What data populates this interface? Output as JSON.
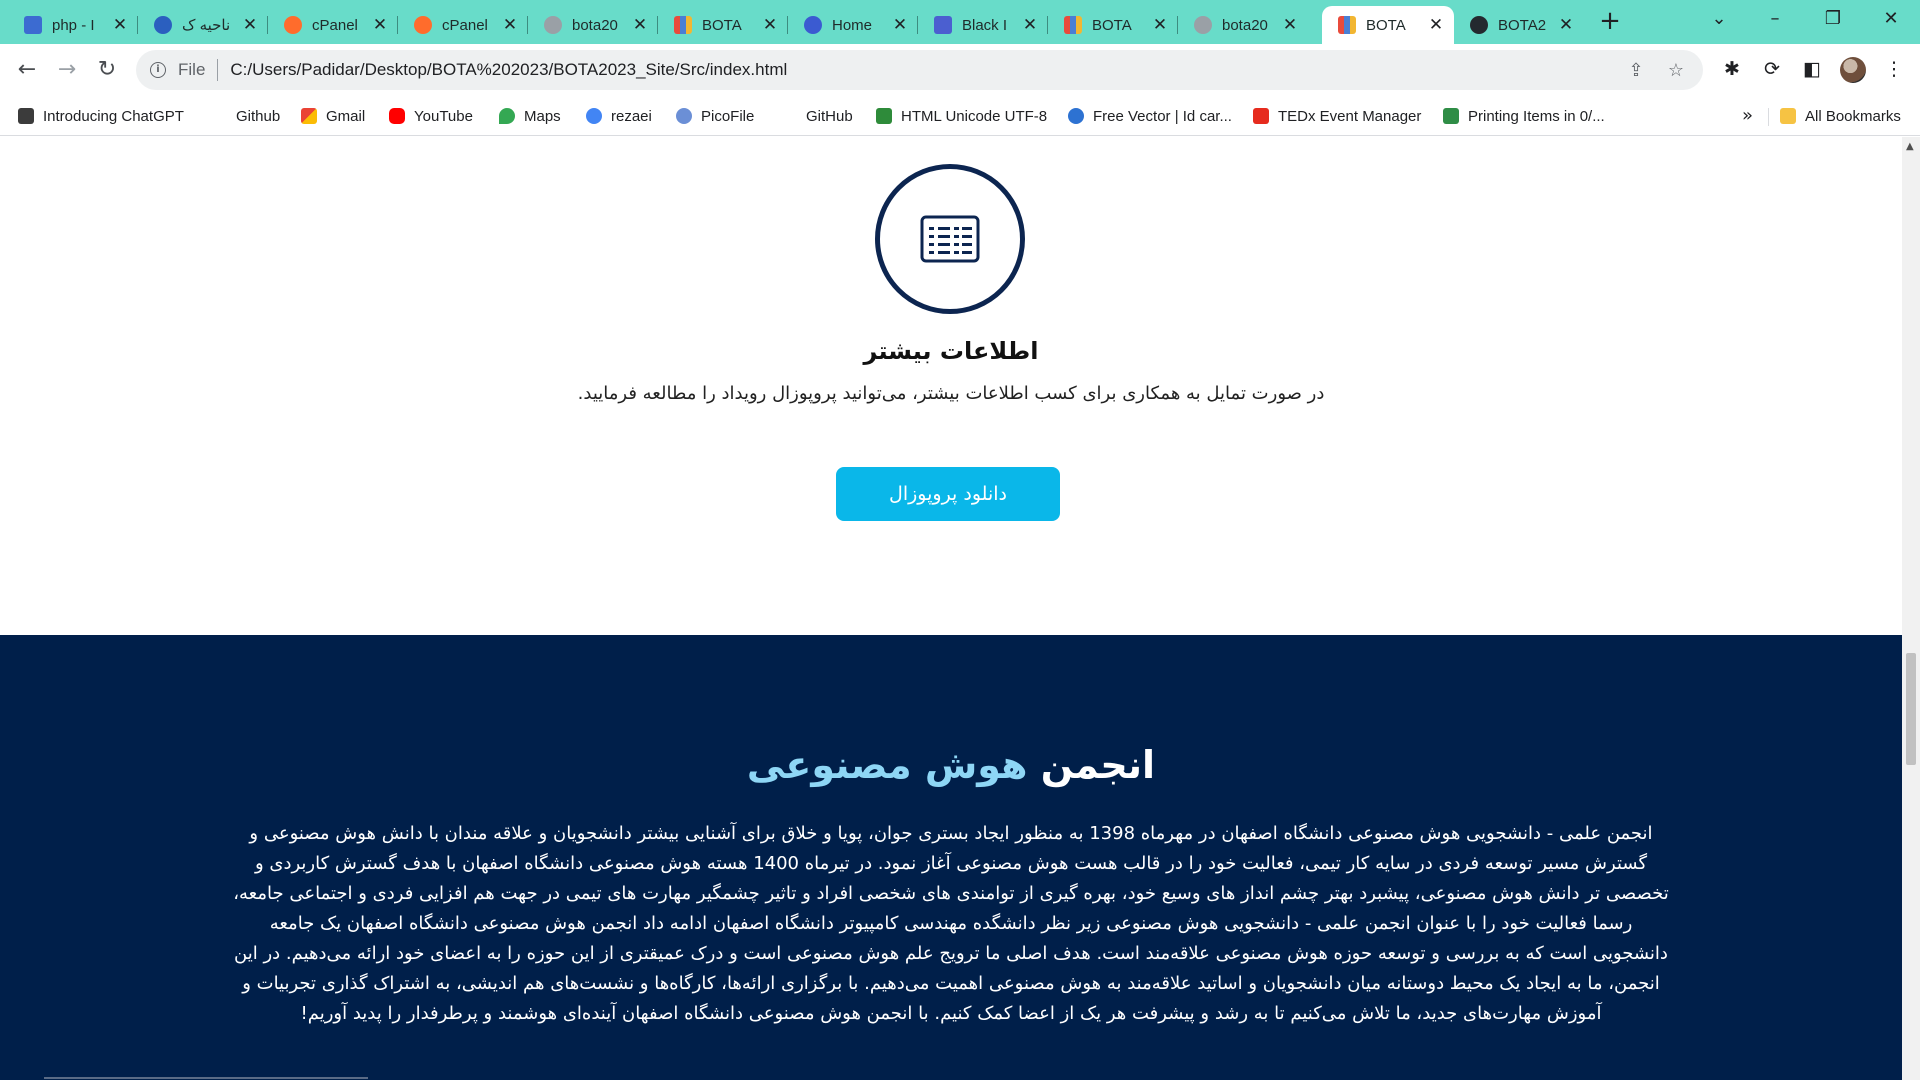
{
  "browser": {
    "tabs": [
      {
        "title": "php - I",
        "favicon": "#3c6bd1",
        "icon": "document-icon"
      },
      {
        "title": "ناحیه ک",
        "favicon": "#2b5fbf",
        "icon": "portal-icon"
      },
      {
        "title": "cPanel",
        "favicon": "#ff6c2c",
        "icon": "cpanel-icon"
      },
      {
        "title": "cPanel",
        "favicon": "#ff6c2c",
        "icon": "cpanel-icon"
      },
      {
        "title": "bota20",
        "favicon": "#9aa0a6",
        "icon": "globe-icon"
      },
      {
        "title": "BOTA",
        "favicon": "#4a7fd4",
        "icon": "grid-logo-icon"
      },
      {
        "title": "Home",
        "favicon": "#3b5bd1",
        "icon": "home-logo-icon"
      },
      {
        "title": "Black I",
        "favicon": "#4b5fd0",
        "icon": "app-icon"
      },
      {
        "title": "BOTA",
        "favicon": "#4a7fd4",
        "icon": "grid-logo-icon"
      },
      {
        "title": "bota20",
        "favicon": "#9aa0a6",
        "icon": "globe-icon"
      },
      {
        "title": "BOTA",
        "favicon": "#4a7fd4",
        "icon": "grid-logo-icon",
        "active": true
      },
      {
        "title": "BOTA2",
        "favicon": "#24292f",
        "icon": "github-icon"
      }
    ],
    "new_tab_label": "+",
    "window_controls": {
      "minimize": "–",
      "restore": "❐",
      "close": "✕",
      "tab_search": "⌄"
    },
    "address": {
      "scheme": "File",
      "url": "C:/Users/Padidar/Desktop/BOTA%202023/BOTA2023_Site/Src/index.html"
    },
    "nav": {
      "back": "←",
      "forward": "→",
      "reload": "↻"
    },
    "bookmarks": [
      {
        "label": "Introducing ChatGPT",
        "favicon": "#3b3b3b",
        "icon": "chatgpt-icon"
      },
      {
        "label": "Github",
        "favicon": "",
        "icon": "none"
      },
      {
        "label": "Gmail",
        "favicon": "#ea4335",
        "icon": "gmail-icon"
      },
      {
        "label": "YouTube",
        "favicon": "#ff0000",
        "icon": "youtube-icon"
      },
      {
        "label": "Maps",
        "favicon": "#34a853",
        "icon": "maps-icon"
      },
      {
        "label": "rezaei",
        "favicon": "#4285f4",
        "icon": "google-icon"
      },
      {
        "label": "PicoFile",
        "favicon": "#6b8fd6",
        "icon": "picofile-icon"
      },
      {
        "label": "GitHub",
        "favicon": "",
        "icon": "none"
      },
      {
        "label": "HTML Unicode UTF-8",
        "favicon": "#2e8b3a",
        "icon": "w3schools-icon"
      },
      {
        "label": "Free Vector | Id car...",
        "favicon": "#2d72d2",
        "icon": "freepik-icon"
      },
      {
        "label": "TEDx Event Manager",
        "favicon": "#e62b1e",
        "icon": "tedx-icon"
      },
      {
        "label": "Printing Items in 0/...",
        "favicon": "#2f8d46",
        "icon": "gfg-icon"
      }
    ],
    "bookmarks_more": "»",
    "all_bookmarks": "All Bookmarks"
  },
  "page": {
    "info_title": "اطلاعات بیشتر",
    "info_text": "در صورت تمایل به همکاری برای کسب اطلاعات بیشتر، می‌توانید پروپوزال رویداد را مطالعه فرمایید.",
    "download_button": "دانلود پروپوزال",
    "section_title_main": "انجمن",
    "section_title_accent": "هوش مصنوعی",
    "section_body": "انجمن علمی - دانشجویی هوش مصنوعی دانشگاه اصفهان در مهرماه 1398 به منظور ایجاد بستری جوان، پویا و خلاق برای آشنایی بیشتر دانشجویان و علاقه مندان با دانش هوش مصنوعی و گسترش مسیر توسعه فردی در سایه کار تیمی، فعالیت خود را در قالب هست هوش مصنوعی آغاز نمود. در تیرماه 1400 هسته هوش مصنوعی دانشگاه اصفهان با هدف گسترش کاربردی و تخصصی تر دانش هوش مصنوعی، پیشبرد بهتر چشم انداز های وسیع خود، بهره گیری از توامندی های شخصی افراد و تاثیر چشمگیر مهارت های تیمی در جهت هم افزایی فردی و اجتماعی جامعه، رسما فعالیت خود را با عنوان انجمن علمی - دانشجویی هوش مصنوعی زیر نظر دانشگده مهندسی کامپیوتر دانشگاه اصفهان ادامه داد انجمن هوش مصنوعی دانشگاه اصفهان یک جامعه دانشجویی است که به بررسی و توسعه حوزه هوش مصنوعی علاقه‌مند است. هدف اصلی ما ترویج علم هوش مصنوعی است و درک عمیقتری از این حوزه را به اعضای خود ارائه می‌دهیم. در این انجمن، ما به ایجاد یک محیط دوستانه میان دانشجویان و اساتید علاقه‌مند به هوش مصنوعی اهمیت می‌دهیم. با برگزاری ارائه‌ها، کارگاه‌ها و نشست‌های هم اندیشی، به اشتراک گذاری تجربیات و آموزش مهارت‌های جدید، ما تلاش می‌کنیم تا به رشد و پیشرفت هر یک از اعضا کمک کنیم. با انجمن هوش مصنوعی دانشگاه اصفهان آینده‌ای هوشمند و پرطرفدار را پدید آوریم!"
  },
  "colors": {
    "tabstrip": "#68dcc9",
    "dark_section": "#001f4a",
    "button": "#0ab7e9",
    "accent_text": "#8ed6f5"
  }
}
